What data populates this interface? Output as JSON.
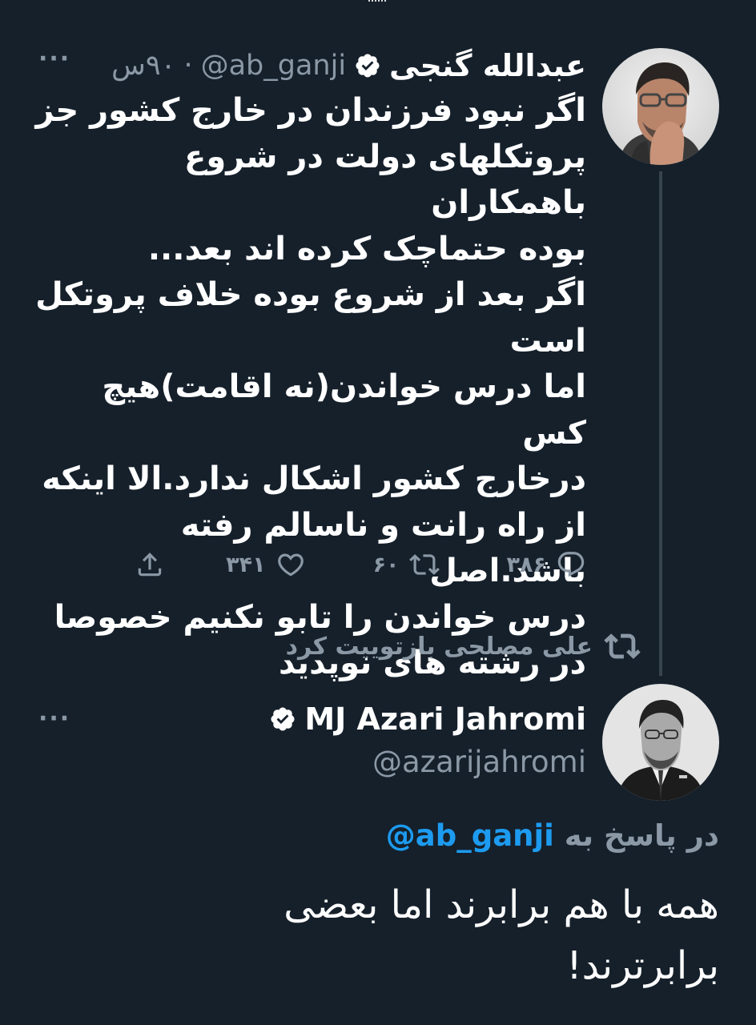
{
  "tweet1": {
    "name": "عبدالله گنجی",
    "handle": "@ab_ganji",
    "separator": "·",
    "time": "۹۰س",
    "more_label": "···",
    "text": "اگر نبود فرزندان در خارج کشور جز\nپروتکلهای دولت در شروع باهمکاران\nبوده حتماچک کرده اند بعد...\nاگر بعد از شروع بوده خلاف پروتکل\nاست\nاما درس خواندن(نه اقامت)هیچ کس\nدرخارج کشور اشکال ندارد.الا اینکه\nاز راه رانت و ناسالم رفته باشد.اصل\nدرس خواندن را تابو نکنیم خصوصا\nدر رشته های نوپدید",
    "replies": "۳۸۶",
    "retweets": "۶۰",
    "likes": "۳۴۱"
  },
  "retweet_indicator": {
    "text": "علی مصلحی بازتوییت کرد"
  },
  "tweet2": {
    "name": "MJ Azari Jahromi",
    "handle": "@azarijahromi",
    "more_label": "···",
    "reply_prefix": "در پاسخ به",
    "reply_mention": "@ab_ganji",
    "text": "همه با هم برابرند اما بعضی\nبرابرترند!"
  },
  "icons": {
    "verified": "verified-badge-icon",
    "reply": "reply-icon",
    "retweet": "retweet-icon",
    "like": "heart-icon",
    "share": "share-icon"
  },
  "colors": {
    "background": "#15202b",
    "text": "#ffffff",
    "muted": "#8b98a5",
    "link": "#1d9bf0",
    "thread_line": "#38444d"
  }
}
